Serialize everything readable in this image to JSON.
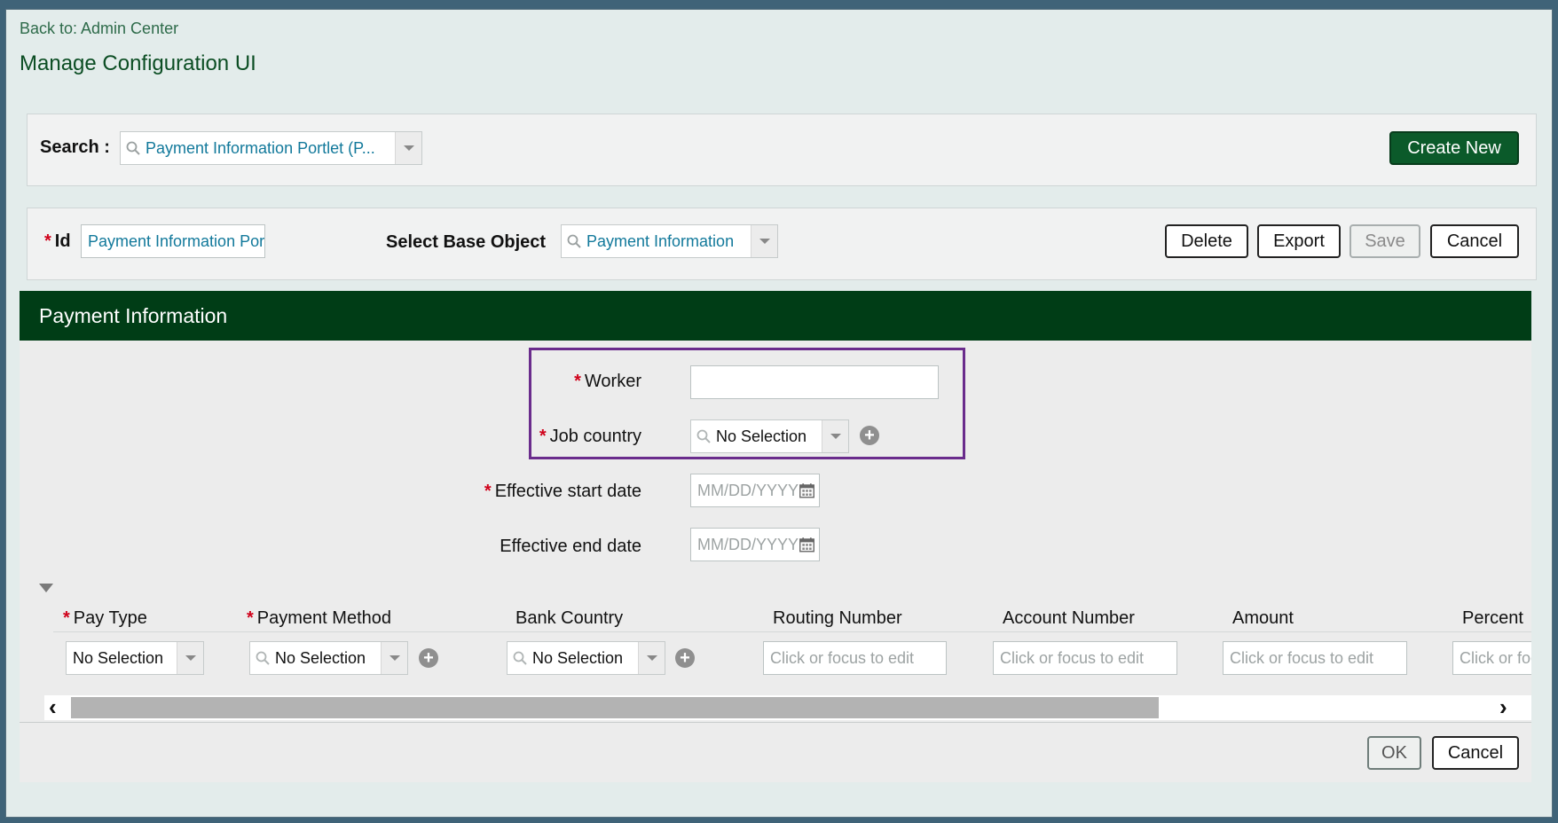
{
  "header": {
    "back_link": "Back to: Admin Center",
    "title": "Manage Configuration UI"
  },
  "search": {
    "label": "Search :",
    "value": "Payment Information Portlet (P...",
    "create_new_label": "Create New"
  },
  "config": {
    "id_label": "Id",
    "id_value": "Payment Information Por",
    "base_object_label": "Select Base Object",
    "base_object_value": "Payment Information",
    "delete_label": "Delete",
    "export_label": "Export",
    "save_label": "Save",
    "cancel_label": "Cancel"
  },
  "section": {
    "title": "Payment Information",
    "fields": {
      "worker_label": "Worker",
      "worker_value": "",
      "job_country_label": "Job country",
      "job_country_value": "No Selection",
      "start_date_label": "Effective start date",
      "start_date_placeholder": "MM/DD/YYYY",
      "end_date_label": "Effective end date",
      "end_date_placeholder": "MM/DD/YYYY"
    },
    "table": {
      "columns": [
        "Pay Type",
        "Payment Method",
        "Bank Country",
        "Routing Number",
        "Account Number",
        "Amount",
        "Percent"
      ],
      "row": {
        "pay_type": "No Selection",
        "payment_method": "No Selection",
        "bank_country": "No Selection",
        "routing_placeholder": "Click or focus to edit",
        "account_placeholder": "Click or focus to edit",
        "amount_placeholder": "Click or focus to edit",
        "percent_placeholder": "Click or focus to edit"
      }
    }
  },
  "footer": {
    "ok_label": "OK",
    "cancel_label": "Cancel"
  },
  "colors": {
    "brand_green": "#003d16",
    "link_teal": "#12799b",
    "required_red": "#d0021b",
    "highlight_purple": "#6a2c8c"
  }
}
